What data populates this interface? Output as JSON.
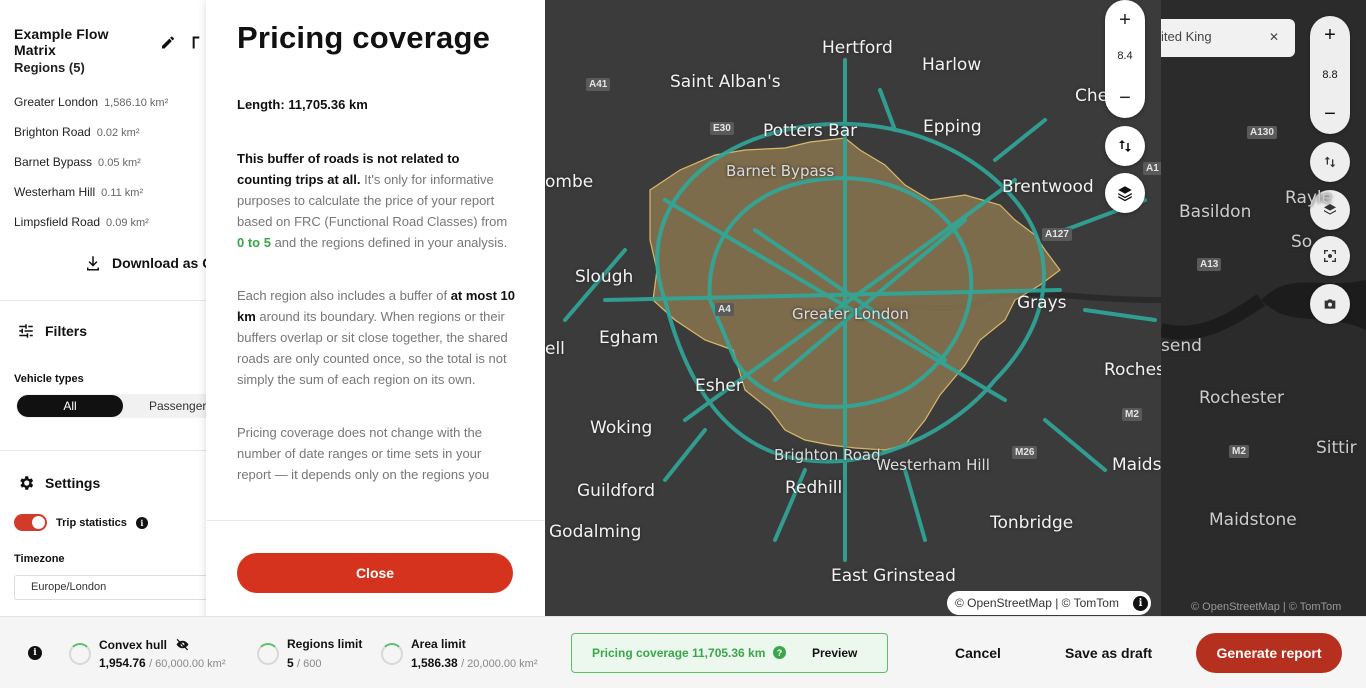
{
  "left_panel": {
    "title": "Example Flow Matrix",
    "regions_title": "Regions (5)",
    "regions": [
      {
        "name": "Greater London",
        "area": "1,586.10 km²"
      },
      {
        "name": "Brighton Road",
        "area": "0.02 km²"
      },
      {
        "name": "Barnet Bypass",
        "area": "0.05 km²"
      },
      {
        "name": "Westerham Hill",
        "area": "0.11 km²"
      },
      {
        "name": "Limpsfield Road",
        "area": "0.09 km²"
      }
    ],
    "download_label": "Download as C",
    "filters_label": "Filters",
    "vehicle_types_label": "Vehicle types",
    "vehicle_types": [
      "All",
      "Passenger"
    ],
    "settings_label": "Settings",
    "trip_statistics_label": "Trip statistics",
    "timezone_label": "Timezone",
    "timezone_value": "Europe/London"
  },
  "modal": {
    "title": "Pricing coverage",
    "length": "Length: 11,705.36 km",
    "p1_bold": "This buffer of roads is not related to counting trips at all.",
    "p1_a": " It's only for informative purposes to calculate the price of your report based on FRC (Functional Road Classes) from ",
    "p1_green": "0 to 5",
    "p1_b": " and the regions defined in your analysis.",
    "p2_a": "Each region also includes a buffer of ",
    "p2_bold": "at most 10 km",
    "p2_b": " around its boundary. When regions or their buffers overlap or sit close together, the shared roads are only counted once, so the total is not simply the sum of each region on its own.",
    "p3": "Pricing coverage does not change with the number of date ranges or time sets in your report — it depends only on the regions you",
    "close_label": "Close"
  },
  "map": {
    "zoom": "8.4",
    "places": [
      {
        "name": "Hertford",
        "size": "lg"
      },
      {
        "name": "Harlow",
        "size": "lg"
      },
      {
        "name": "Saint Alban's",
        "size": "lg"
      },
      {
        "name": "Potters Bar",
        "size": "lg"
      },
      {
        "name": "Epping",
        "size": "lg"
      },
      {
        "name": "Barnet Bypass",
        "size": "sm"
      },
      {
        "name": "Brentwood",
        "size": "lg"
      },
      {
        "name": "Slough",
        "size": "lg"
      },
      {
        "name": "Greater London",
        "size": "sm"
      },
      {
        "name": "Grays",
        "size": "lg"
      },
      {
        "name": "Egham",
        "size": "lg"
      },
      {
        "name": "Esher",
        "size": "lg"
      },
      {
        "name": "Woking",
        "size": "lg"
      },
      {
        "name": "Brighton Road",
        "size": "sm"
      },
      {
        "name": "Westerham Hill",
        "size": "sm"
      },
      {
        "name": "Redhill",
        "size": "lg"
      },
      {
        "name": "Guildford",
        "size": "lg"
      },
      {
        "name": "Godalming",
        "size": "lg"
      },
      {
        "name": "Tonbridge",
        "size": "lg"
      },
      {
        "name": "East Grinstead",
        "size": "lg"
      },
      {
        "name": "Roches",
        "size": "lg"
      },
      {
        "name": "Maids",
        "size": "lg"
      },
      {
        "name": "Che",
        "size": "lg"
      },
      {
        "name": "ombe",
        "size": "lg"
      },
      {
        "name": "ell",
        "size": "lg"
      }
    ],
    "road_badges": [
      "A41",
      "E30",
      "A127",
      "A4",
      "M26",
      "M2",
      "A1"
    ],
    "attribution": "© OpenStreetMap | © TomTom",
    "colors": {
      "coverage": "#2fa89a",
      "region_fill": "#8a7550",
      "region_edge": "#d8b96a"
    }
  },
  "bg_map": {
    "search_text": "ited King",
    "zoom": "8.8",
    "places": [
      "Basildon",
      "Rayle",
      "So",
      "send",
      "Rochester",
      "Maidstone",
      "Sittir"
    ],
    "road_badges": [
      "A130",
      "A13",
      "M2"
    ],
    "attribution": "© OpenStreetMap | © TomTom"
  },
  "footer": {
    "convex_hull_label": "Convex hull",
    "convex_hull_value": "1,954.76",
    "convex_hull_limit": "/ 60,000.00 km²",
    "regions_limit_label": "Regions limit",
    "regions_limit_value": "5",
    "regions_limit_max": "/ 600",
    "area_limit_label": "Area limit",
    "area_limit_value": "1,586.38",
    "area_limit_max": "/ 20,000.00 km²",
    "pricing_label": "Pricing coverage",
    "pricing_value": "11,705.36 km",
    "preview_label": "Preview",
    "cancel_label": "Cancel",
    "save_draft_label": "Save as draft",
    "generate_label": "Generate report"
  }
}
